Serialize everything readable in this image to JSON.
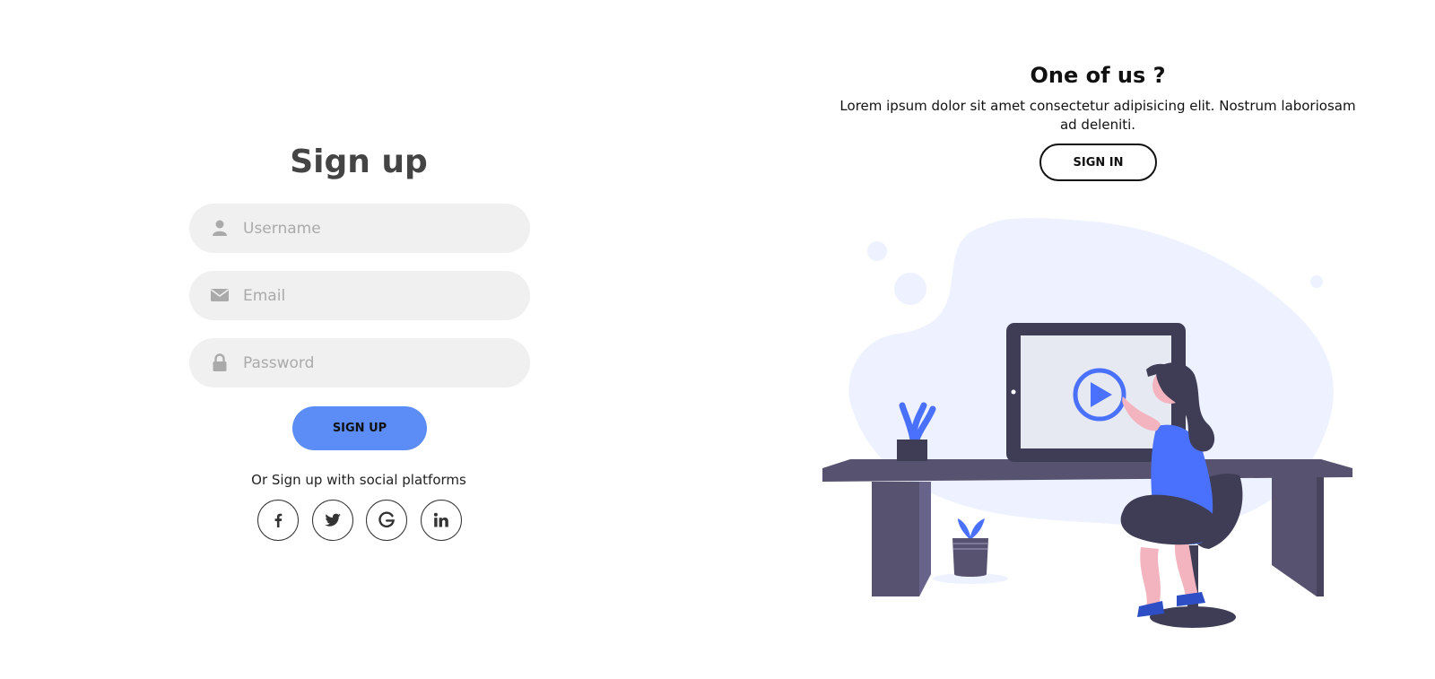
{
  "signup": {
    "title": "Sign up",
    "username_placeholder": "Username",
    "email_placeholder": "Email",
    "password_placeholder": "Password",
    "submit_label": "SIGN UP",
    "social_text": "Or Sign up with social platforms",
    "social_icons": [
      "facebook-icon",
      "twitter-icon",
      "google-icon",
      "linkedin-icon"
    ]
  },
  "panel": {
    "title": "One of us ?",
    "text": "Lorem ipsum dolor sit amet consectetur adipisicing elit. Nostrum laboriosam ad deleniti.",
    "button_label": "SIGN IN"
  },
  "colors": {
    "primary": "#5c8df6",
    "input_bg": "#f0f0f0",
    "illustration_accent": "#4971fe",
    "desk": "#57526f",
    "blob": "#eef1ff"
  }
}
